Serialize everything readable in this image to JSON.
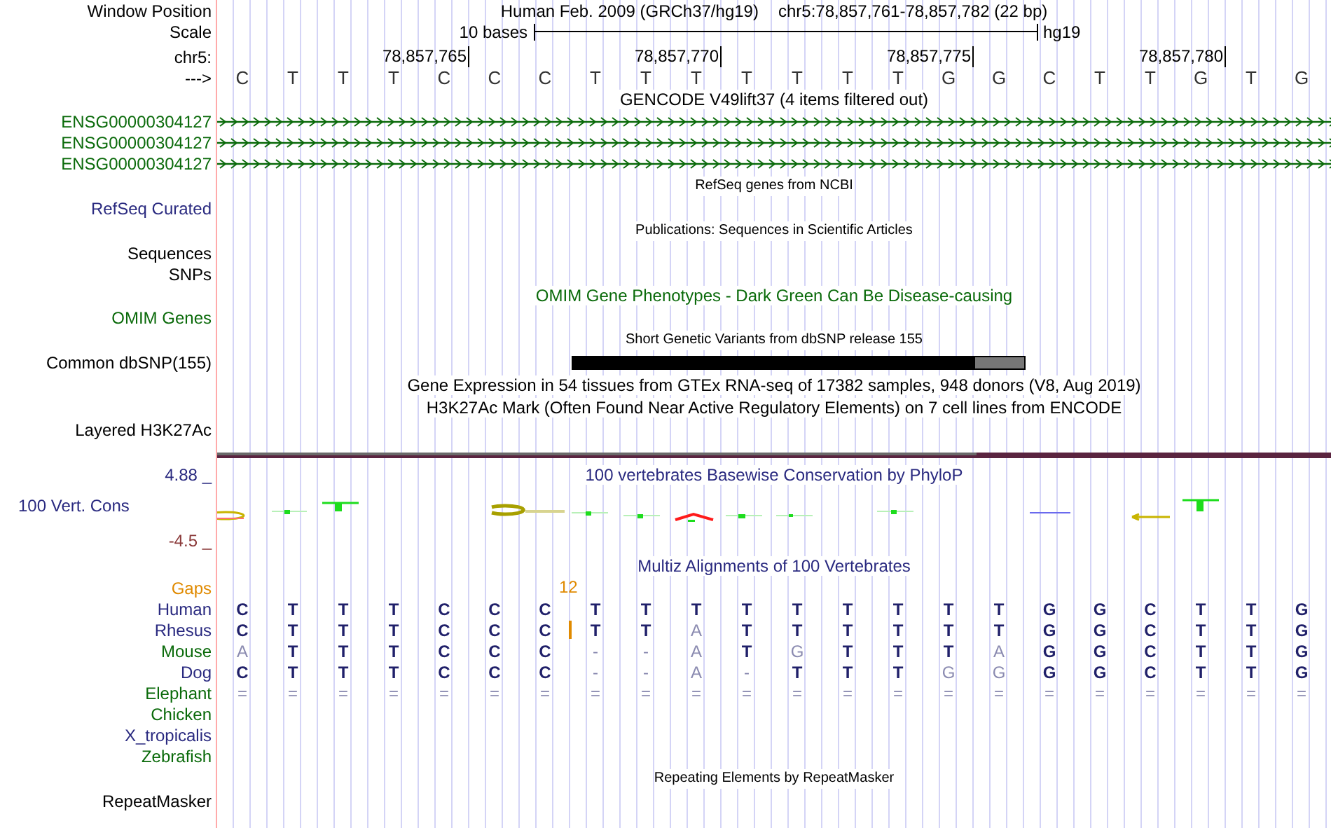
{
  "header": {
    "label": "Window Position",
    "assembly": "Human Feb. 2009 (GRCh37/hg19)",
    "position": "chr5:78,857,761-78,857,782 (22 bp)"
  },
  "scale": {
    "label": "Scale",
    "length": "10 bases",
    "assembly": "hg19"
  },
  "ruler": {
    "label": "chr5:",
    "ticks": [
      "78,857,765",
      "78,857,770",
      "78,857,775",
      "78,857,780"
    ]
  },
  "sequence": {
    "label": "--->",
    "bases": [
      "C",
      "T",
      "T",
      "T",
      "C",
      "C",
      "C",
      "T",
      "T",
      "T",
      "T",
      "T",
      "T",
      "T",
      "G",
      "G",
      "C",
      "T",
      "T",
      "G",
      "T",
      "G"
    ]
  },
  "tracks": [
    {
      "kind": "title",
      "text": "GENCODE V49lift37 (4 items filtered out)",
      "color": "#000000"
    },
    {
      "kind": "gene",
      "label": "ENSG00000304127",
      "color": "#0a6a0a"
    },
    {
      "kind": "gene",
      "label": "ENSG00000304127",
      "color": "#0a6a0a"
    },
    {
      "kind": "gene",
      "label": "ENSG00000304127",
      "color": "#0a6a0a"
    },
    {
      "kind": "small_title",
      "text": "RefSeq genes from NCBI"
    },
    {
      "kind": "label",
      "label": "RefSeq Curated",
      "color": "#2a2a80"
    },
    {
      "kind": "small_title",
      "text": "Publications: Sequences in Scientific Articles"
    },
    {
      "kind": "label",
      "label": "Sequences",
      "color": "#000000"
    },
    {
      "kind": "label",
      "label": "SNPs",
      "color": "#000000"
    },
    {
      "kind": "title",
      "text": "OMIM Gene Phenotypes - Dark Green Can Be Disease-causing",
      "color": "#0a6a0a"
    },
    {
      "kind": "label",
      "label": "OMIM Genes",
      "color": "#0a6a0a"
    },
    {
      "kind": "small_title",
      "text": "Short Genetic Variants from dbSNP release 155"
    },
    {
      "kind": "snp_bar",
      "label": "Common dbSNP(155)",
      "color": "#000000"
    },
    {
      "kind": "title",
      "text": "Gene Expression in 54 tissues from GTEx RNA-seq of 17382 samples, 948 donors (V8, Aug 2019)",
      "color": "#000000"
    },
    {
      "kind": "title",
      "text": "H3K27Ac Mark (Often Found Near Active Regulatory Elements) on 7 cell lines from ENCODE",
      "color": "#000000"
    },
    {
      "kind": "label",
      "label": "Layered H3K27Ac",
      "color": "#000000"
    },
    {
      "kind": "layer_line"
    },
    {
      "kind": "conservation",
      "label": "100 Vert. Cons",
      "max": "4.88 _",
      "min": "-4.5 _",
      "title": "100 vertebrates Basewise Conservation by PhyloP"
    },
    {
      "kind": "title",
      "text": "Multiz Alignments of 100 Vertebrates",
      "color": "#2a2a80"
    },
    {
      "kind": "gaps",
      "label": "Gaps",
      "items": [
        {
          "text": "12"
        }
      ]
    },
    {
      "kind": "species",
      "label": "Human",
      "color": "#2a2a80",
      "bases": [
        {
          "b": "C",
          "match": true
        },
        {
          "b": "T",
          "match": true
        },
        {
          "b": "T",
          "match": true
        },
        {
          "b": "T",
          "match": true
        },
        {
          "b": "C",
          "match": true
        },
        {
          "b": "C",
          "match": true
        },
        {
          "b": "C",
          "match": true
        },
        {
          "b": "T",
          "match": true
        },
        {
          "b": "T",
          "match": true
        },
        {
          "b": "T",
          "match": true
        },
        {
          "b": "T",
          "match": true
        },
        {
          "b": "T",
          "match": true
        },
        {
          "b": "T",
          "match": true
        },
        {
          "b": "T",
          "match": true
        },
        {
          "b": "T",
          "match": true
        },
        {
          "b": "T",
          "match": true
        },
        {
          "b": "G",
          "match": true
        },
        {
          "b": "G",
          "match": true
        },
        {
          "b": "C",
          "match": true
        },
        {
          "b": "T",
          "match": true
        },
        {
          "b": "T",
          "match": true
        },
        {
          "b": "G",
          "match": true
        }
      ]
    },
    {
      "kind": "species",
      "label": "Rhesus",
      "color": "#2a2a80",
      "insertion": true,
      "bases": [
        {
          "b": "C",
          "match": true
        },
        {
          "b": "T",
          "match": true
        },
        {
          "b": "T",
          "match": true
        },
        {
          "b": "T",
          "match": true
        },
        {
          "b": "C",
          "match": true
        },
        {
          "b": "C",
          "match": true
        },
        {
          "b": "C",
          "match": true
        },
        {
          "b": "T",
          "match": true
        },
        {
          "b": "T",
          "match": true
        },
        {
          "b": "A",
          "match": false
        },
        {
          "b": "T",
          "match": true
        },
        {
          "b": "T",
          "match": true
        },
        {
          "b": "T",
          "match": true
        },
        {
          "b": "T",
          "match": true
        },
        {
          "b": "T",
          "match": true
        },
        {
          "b": "T",
          "match": true
        },
        {
          "b": "G",
          "match": true
        },
        {
          "b": "G",
          "match": true
        },
        {
          "b": "C",
          "match": true
        },
        {
          "b": "T",
          "match": true
        },
        {
          "b": "T",
          "match": true
        },
        {
          "b": "G",
          "match": true
        }
      ]
    },
    {
      "kind": "species",
      "label": "Mouse",
      "color": "#0a6a0a",
      "bases": [
        {
          "b": "A",
          "match": false
        },
        {
          "b": "T",
          "match": true
        },
        {
          "b": "T",
          "match": true
        },
        {
          "b": "T",
          "match": true
        },
        {
          "b": "C",
          "match": true
        },
        {
          "b": "C",
          "match": true
        },
        {
          "b": "C",
          "match": true
        },
        {
          "b": "-",
          "match": false
        },
        {
          "b": "-",
          "match": false
        },
        {
          "b": "A",
          "match": false
        },
        {
          "b": "T",
          "match": true
        },
        {
          "b": "G",
          "match": false
        },
        {
          "b": "T",
          "match": true
        },
        {
          "b": "T",
          "match": true
        },
        {
          "b": "T",
          "match": true
        },
        {
          "b": "A",
          "match": false
        },
        {
          "b": "G",
          "match": true
        },
        {
          "b": "G",
          "match": true
        },
        {
          "b": "C",
          "match": true
        },
        {
          "b": "T",
          "match": true
        },
        {
          "b": "T",
          "match": true
        },
        {
          "b": "G",
          "match": true
        }
      ]
    },
    {
      "kind": "species",
      "label": "Dog",
      "color": "#2a2a80",
      "bases": [
        {
          "b": "C",
          "match": true
        },
        {
          "b": "T",
          "match": true
        },
        {
          "b": "T",
          "match": true
        },
        {
          "b": "T",
          "match": true
        },
        {
          "b": "C",
          "match": true
        },
        {
          "b": "C",
          "match": true
        },
        {
          "b": "C",
          "match": true
        },
        {
          "b": "-",
          "match": false
        },
        {
          "b": "-",
          "match": false
        },
        {
          "b": "A",
          "match": false
        },
        {
          "b": "-",
          "match": false
        },
        {
          "b": "T",
          "match": true
        },
        {
          "b": "T",
          "match": true
        },
        {
          "b": "T",
          "match": true
        },
        {
          "b": "G",
          "match": false
        },
        {
          "b": "G",
          "match": false
        },
        {
          "b": "G",
          "match": true
        },
        {
          "b": "G",
          "match": true
        },
        {
          "b": "C",
          "match": true
        },
        {
          "b": "T",
          "match": true
        },
        {
          "b": "T",
          "match": true
        },
        {
          "b": "G",
          "match": true
        }
      ]
    },
    {
      "kind": "species",
      "label": "Elephant",
      "color": "#0a6a0a",
      "bases": [
        {
          "b": "=",
          "match": false
        },
        {
          "b": "=",
          "match": false
        },
        {
          "b": "=",
          "match": false
        },
        {
          "b": "=",
          "match": false
        },
        {
          "b": "=",
          "match": false
        },
        {
          "b": "=",
          "match": false
        },
        {
          "b": "=",
          "match": false
        },
        {
          "b": "=",
          "match": false
        },
        {
          "b": "=",
          "match": false
        },
        {
          "b": "=",
          "match": false
        },
        {
          "b": "=",
          "match": false
        },
        {
          "b": "=",
          "match": false
        },
        {
          "b": "=",
          "match": false
        },
        {
          "b": "=",
          "match": false
        },
        {
          "b": "=",
          "match": false
        },
        {
          "b": "=",
          "match": false
        },
        {
          "b": "=",
          "match": false
        },
        {
          "b": "=",
          "match": false
        },
        {
          "b": "=",
          "match": false
        },
        {
          "b": "=",
          "match": false
        },
        {
          "b": "=",
          "match": false
        },
        {
          "b": "=",
          "match": false
        }
      ]
    },
    {
      "kind": "species",
      "label": "Chicken",
      "color": "#0a6a0a"
    },
    {
      "kind": "species",
      "label": "X_tropicalis",
      "color": "#2a2a80"
    },
    {
      "kind": "species",
      "label": "Zebrafish",
      "color": "#0a6a0a"
    },
    {
      "kind": "small_title",
      "text": "Repeating Elements by RepeatMasker"
    },
    {
      "kind": "label",
      "label": "RepeatMasker",
      "color": "#000000"
    }
  ]
}
